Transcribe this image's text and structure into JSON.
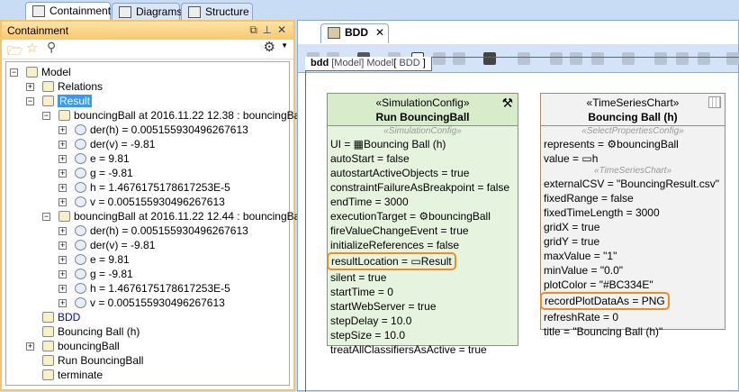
{
  "tabs": [
    "Containment",
    "Diagrams",
    "Structure"
  ],
  "panel_title": "Containment",
  "tree": [
    {
      "l": 0,
      "t": "Model",
      "exp": "-",
      "icon": "package-icon"
    },
    {
      "l": 1,
      "t": "Relations",
      "exp": "+",
      "icon": "relations-icon"
    },
    {
      "l": 1,
      "t": "Result",
      "exp": "-",
      "icon": "folder-icon",
      "sel": true
    },
    {
      "l": 2,
      "t": "bouncingBall at 2016.11.22 12.38 : bouncingBall",
      "exp": "-",
      "icon": "instance-icon"
    },
    {
      "l": 3,
      "t": "der(h) = 0.005155930496267613",
      "exp": "+",
      "icon": "property-icon"
    },
    {
      "l": 3,
      "t": "der(v) = -9.81",
      "exp": "+",
      "icon": "property-icon"
    },
    {
      "l": 3,
      "t": "e = 9.81",
      "exp": "+",
      "icon": "property-icon"
    },
    {
      "l": 3,
      "t": "g = -9.81",
      "exp": "+",
      "icon": "property-icon"
    },
    {
      "l": 3,
      "t": "h = 1.4676175178617253E-5",
      "exp": "+",
      "icon": "property-icon"
    },
    {
      "l": 3,
      "t": "v = 0.005155930496267613",
      "exp": "+",
      "icon": "property-icon"
    },
    {
      "l": 2,
      "t": "bouncingBall at 2016.11.22 12.44 : bouncingBall",
      "exp": "-",
      "icon": "instance-icon"
    },
    {
      "l": 3,
      "t": "der(h) = 0.005155930496267613",
      "exp": "+",
      "icon": "property-icon"
    },
    {
      "l": 3,
      "t": "der(v) = -9.81",
      "exp": "+",
      "icon": "property-icon"
    },
    {
      "l": 3,
      "t": "e = 9.81",
      "exp": "+",
      "icon": "property-icon"
    },
    {
      "l": 3,
      "t": "g = -9.81",
      "exp": "+",
      "icon": "property-icon"
    },
    {
      "l": 3,
      "t": "h = 1.4676175178617253E-5",
      "exp": "+",
      "icon": "property-icon"
    },
    {
      "l": 3,
      "t": "v = 0.005155930496267613",
      "exp": "+",
      "icon": "property-icon"
    },
    {
      "l": 1,
      "t": "BDD",
      "icon": "bdd-diagram-icon",
      "link": true
    },
    {
      "l": 1,
      "t": "Bouncing Ball (h)",
      "icon": "time-series-chart-icon"
    },
    {
      "l": 1,
      "t": "bouncingBall",
      "exp": "+",
      "icon": "gear-icon"
    },
    {
      "l": 1,
      "t": "Run BouncingBall",
      "icon": "tools-icon"
    },
    {
      "l": 1,
      "t": "terminate",
      "icon": "signal-icon"
    }
  ],
  "editor_tab": "BDD",
  "frame": {
    "kind": "bdd",
    "ctx": "[Model]",
    "name": "Model",
    "bracket_open": "[",
    "diagram": "BDD",
    "bracket_close": "]"
  },
  "block1": {
    "stereo": "«SimulationConfig»",
    "name": "Run BouncingBall",
    "sub": "«SimulationConfig»",
    "props": [
      "UI = ▦Bouncing Ball (h)",
      "autoStart = false",
      "autostartActiveObjects = true",
      "constraintFailureAsBreakpoint = false",
      "endTime = 3000",
      "executionTarget = ⚙bouncingBall",
      "fireValueChangeEvent = true",
      "initializeReferences = false",
      "resultLocation = ▭Result",
      "silent = true",
      "startTime = 0",
      "startWebServer = true",
      "stepDelay = 10.0",
      "stepSize = 10.0",
      "treatAllClassifiersAsActive = true"
    ],
    "highlight": 8
  },
  "block2": {
    "stereo": "«TimeSeriesChart»",
    "name": "Bouncing Ball (h)",
    "sub1": "«SelectPropertiesConfig»",
    "props1": [
      "represents = ⚙bouncingBall",
      "value = ▭h"
    ],
    "sub2": "«TimeSeriesChart»",
    "props2": [
      "externalCSV = \"BouncingResult.csv\"",
      "fixedRange = false",
      "fixedTimeLength = 3000",
      "gridX = true",
      "gridY = true",
      "maxValue = \"1\"",
      "minValue = \"0.0\"",
      "plotColor = \"#BC334E\"",
      "recordPlotDataAs = PNG",
      "refreshRate = 0",
      "title = \"Bouncing Ball (h)\""
    ],
    "highlight": 8
  },
  "colors": {
    "highlight": "#F08A24",
    "sim_block": "#E6F4DF",
    "chart_block": "#F2F2F2",
    "selection": "#3399FF"
  }
}
